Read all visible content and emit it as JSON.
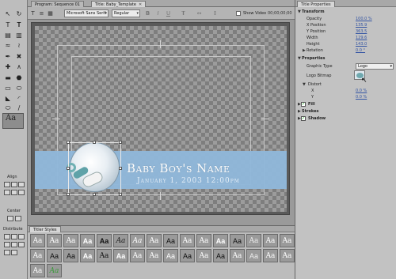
{
  "program_tabs": [
    {
      "label": "Program: Sequence 01"
    },
    {
      "label": "Title: Baby_Template",
      "active": true
    }
  ],
  "toolbar": {
    "font_family": "Microsoft Sans Serif",
    "font_style": "Regular",
    "bold": "B",
    "italic": "I",
    "underline": "U",
    "show_video_label": "Show Video",
    "timecode": "00;00;00;00"
  },
  "canvas": {
    "title_name": "Baby Boy's Name",
    "title_date": "January 1, 2003 12:00pm",
    "band_color": "#8fb7d9"
  },
  "tools": {
    "selected_style_label": "Aa",
    "align_label": "Align",
    "center_label": "Center",
    "distribute_label": "Distribute"
  },
  "titler_styles": {
    "tab_label": "Titler Styles",
    "row1": [
      "Aa",
      "Aa",
      "Aa",
      "Aa",
      "Aa",
      "Aa",
      "Aa",
      "Aa",
      "Aa",
      "Aa",
      "Aa",
      "Aa",
      "Aa",
      "Aa",
      "Aa",
      "Aa"
    ],
    "row2": [
      "Aa",
      "Aa",
      "Aa",
      "Aa",
      "Aa",
      "Aa",
      "Aa",
      "Aa",
      "Aa",
      "Aa",
      "Aa",
      "Aa",
      "Aa",
      "Aa",
      "Aa",
      "Aa"
    ],
    "row3": [
      "Aa",
      "Aa"
    ]
  },
  "properties": {
    "tab_label": "Title Properties",
    "transform": "Transform",
    "opacity_label": "Opacity",
    "opacity_value": "100.0 %",
    "xpos_label": "X Position",
    "xpos_value": "135.9",
    "ypos_label": "Y Position",
    "ypos_value": "363.5",
    "width_label": "Width",
    "width_value": "129.6",
    "height_label": "Height",
    "height_value": "143.0",
    "rotation_label": "Rotation",
    "rotation_value": "0.0 °",
    "properties": "Properties",
    "graphic_type_label": "Graphic Type",
    "graphic_type_value": "Logo",
    "logo_bitmap_label": "Logo Bitmap",
    "distort_label": "Distort",
    "x_label": "X",
    "x_value": "0.0 %",
    "y_label": "Y",
    "y_value": "0.0 %",
    "fill_label": "Fill",
    "strokes_label": "Strokes",
    "shadow_label": "Shadow"
  }
}
